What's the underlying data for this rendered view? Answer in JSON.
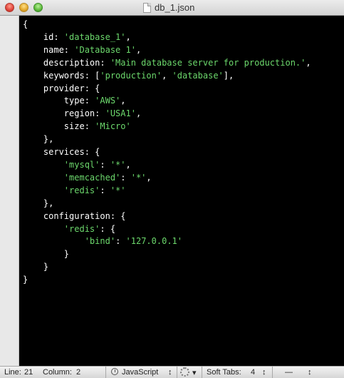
{
  "window": {
    "title": "db_1.json"
  },
  "editor": {
    "lines": [
      [
        {
          "t": "{",
          "c": "plain"
        }
      ],
      [
        {
          "t": "    id: ",
          "c": "plain"
        },
        {
          "t": "'database_1'",
          "c": "str"
        },
        {
          "t": ",",
          "c": "plain"
        }
      ],
      [
        {
          "t": "    name: ",
          "c": "plain"
        },
        {
          "t": "'Database 1'",
          "c": "str"
        },
        {
          "t": ",",
          "c": "plain"
        }
      ],
      [
        {
          "t": "    description: ",
          "c": "plain"
        },
        {
          "t": "'Main database server for production.'",
          "c": "str"
        },
        {
          "t": ",",
          "c": "plain"
        }
      ],
      [
        {
          "t": "    keywords: [",
          "c": "plain"
        },
        {
          "t": "'production'",
          "c": "str"
        },
        {
          "t": ", ",
          "c": "plain"
        },
        {
          "t": "'database'",
          "c": "str"
        },
        {
          "t": "],",
          "c": "plain"
        }
      ],
      [
        {
          "t": "    provider: {",
          "c": "plain"
        }
      ],
      [
        {
          "t": "        type: ",
          "c": "plain"
        },
        {
          "t": "'AWS'",
          "c": "str"
        },
        {
          "t": ",",
          "c": "plain"
        }
      ],
      [
        {
          "t": "        region: ",
          "c": "plain"
        },
        {
          "t": "'USA1'",
          "c": "str"
        },
        {
          "t": ",",
          "c": "plain"
        }
      ],
      [
        {
          "t": "        size: ",
          "c": "plain"
        },
        {
          "t": "'Micro'",
          "c": "str"
        }
      ],
      [
        {
          "t": "    },",
          "c": "plain"
        }
      ],
      [
        {
          "t": "    services: {",
          "c": "plain"
        }
      ],
      [
        {
          "t": "        ",
          "c": "plain"
        },
        {
          "t": "'mysql'",
          "c": "str"
        },
        {
          "t": ": ",
          "c": "plain"
        },
        {
          "t": "'*'",
          "c": "str"
        },
        {
          "t": ",",
          "c": "plain"
        }
      ],
      [
        {
          "t": "        ",
          "c": "plain"
        },
        {
          "t": "'memcached'",
          "c": "str"
        },
        {
          "t": ": ",
          "c": "plain"
        },
        {
          "t": "'*'",
          "c": "str"
        },
        {
          "t": ",",
          "c": "plain"
        }
      ],
      [
        {
          "t": "        ",
          "c": "plain"
        },
        {
          "t": "'redis'",
          "c": "str"
        },
        {
          "t": ": ",
          "c": "plain"
        },
        {
          "t": "'*'",
          "c": "str"
        }
      ],
      [
        {
          "t": "    },",
          "c": "plain"
        }
      ],
      [
        {
          "t": "    configuration: {",
          "c": "plain"
        }
      ],
      [
        {
          "t": "        ",
          "c": "plain"
        },
        {
          "t": "'redis'",
          "c": "str"
        },
        {
          "t": ": {",
          "c": "plain"
        }
      ],
      [
        {
          "t": "            ",
          "c": "plain"
        },
        {
          "t": "'bind'",
          "c": "str"
        },
        {
          "t": ": ",
          "c": "plain"
        },
        {
          "t": "'127.0.0.1'",
          "c": "str"
        }
      ],
      [
        {
          "t": "        }",
          "c": "plain"
        }
      ],
      [
        {
          "t": "    }",
          "c": "plain"
        }
      ],
      [
        {
          "t": "}",
          "c": "plain"
        }
      ]
    ]
  },
  "statusbar": {
    "line_label": "Line:",
    "line_value": "21",
    "column_label": "Column:",
    "column_value": "2",
    "language": "JavaScript",
    "language_arrow": "↕",
    "gear_arrow": "▾",
    "tabs_label": "Soft Tabs:",
    "tabs_value": "4",
    "tabs_arrow": "↕",
    "symbol_value": "—",
    "symbol_arrow": "↕"
  },
  "colors": {
    "string": "#6cd86c",
    "text": "#ffffff",
    "background": "#000000"
  }
}
